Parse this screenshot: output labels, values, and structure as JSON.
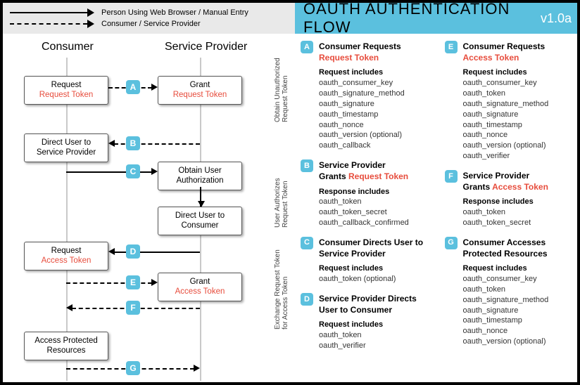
{
  "legend": {
    "solid": "Person Using Web Browser / Manual Entry",
    "dashed": "Consumer / Service Provider"
  },
  "title": "OAUTH AUTHENTICATION FLOW",
  "version": "v1.0a",
  "columns": {
    "consumer": "Consumer",
    "provider": "Service Provider"
  },
  "phases": {
    "p1": "Obtain Unauthorized\nRequest Token",
    "p2": "User Authorizes\nRequest Token",
    "p3": "Exchange Request Token\nfor Access Token"
  },
  "boxes": {
    "b1a": "Request",
    "b1b": "Request Token",
    "b2a": "Grant",
    "b2b": "Request Token",
    "b3": "Direct User to\nService Provider",
    "b4": "Obtain User\nAuthorization",
    "b5": "Direct User to\nConsumer",
    "b6a": "Request",
    "b6b": "Access Token",
    "b7a": "Grant",
    "b7b": "Access Token",
    "b8": "Access Protected\nResources"
  },
  "badges": {
    "A": "A",
    "B": "B",
    "C": "C",
    "D": "D",
    "E": "E",
    "F": "F",
    "G": "G"
  },
  "steps": {
    "A": {
      "title": "Consumer Requests",
      "red": "Request Token",
      "sub": "Request includes",
      "list": [
        "oauth_consumer_key",
        "oauth_signature_method",
        "oauth_signature",
        "oauth_timestamp",
        "oauth_nonce",
        "oauth_version (optional)",
        "oauth_callback"
      ]
    },
    "B": {
      "title": "Service Provider",
      "title2": "Grants ",
      "red": "Request Token",
      "sub": "Response includes",
      "list": [
        "oauth_token",
        "oauth_token_secret",
        "oauth_callback_confirmed"
      ]
    },
    "C": {
      "title": "Consumer Directs User to Service Provider",
      "sub": "Request includes",
      "list": [
        "oauth_token (optional)"
      ]
    },
    "D": {
      "title": "Service Provider Directs User to Consumer",
      "sub": "Request includes",
      "list": [
        "oauth_token",
        "oauth_verifier"
      ]
    },
    "E": {
      "title": "Consumer Requests",
      "red": "Access Token",
      "sub": "Request includes",
      "list": [
        "oauth_consumer_key",
        "oauth_token",
        "oauth_signature_method",
        "oauth_signature",
        "oauth_timestamp",
        "oauth_nonce",
        "oauth_version (optional)",
        "oauth_verifier"
      ]
    },
    "F": {
      "title": "Service Provider",
      "title2": "Grants ",
      "red": "Access Token",
      "sub": "Response includes",
      "list": [
        "oauth_token",
        "oauth_token_secret"
      ]
    },
    "G": {
      "title": "Consumer Accesses Protected Resources",
      "sub": "Request includes",
      "list": [
        "oauth_consumer_key",
        "oauth_token",
        "oauth_signature_method",
        "oauth_signature",
        "oauth_timestamp",
        "oauth_nonce",
        "oauth_version (optional)"
      ]
    }
  }
}
